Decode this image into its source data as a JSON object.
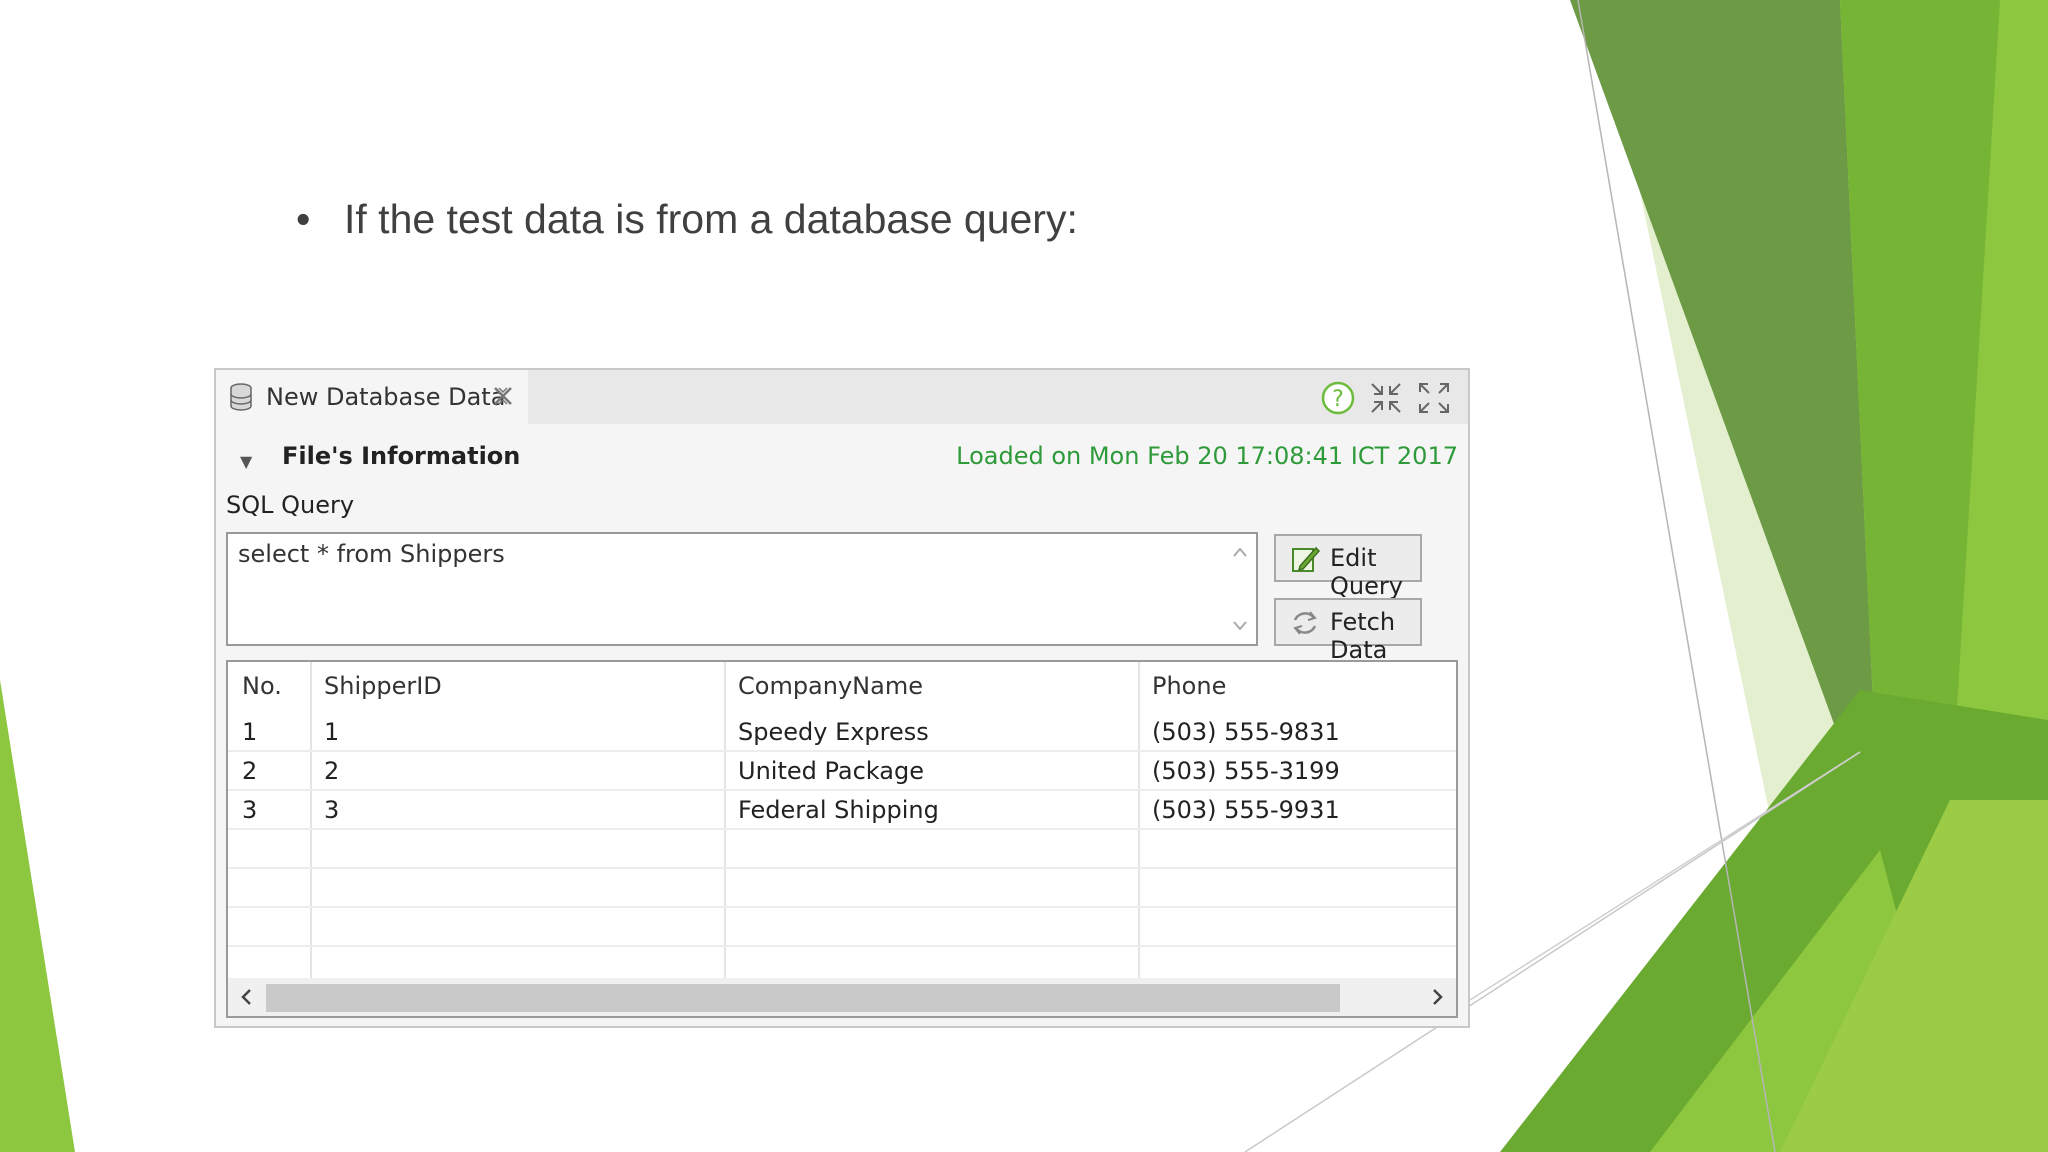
{
  "slide": {
    "bullet_symbol": "•",
    "bullet_text": "If the test data is from a database query:"
  },
  "window": {
    "tab_title": "New Database Data",
    "tab_icon": "database-icon",
    "tab_close_icon": "close-icon",
    "toolbar_icons": [
      "help-icon",
      "minimize-icon",
      "maximize-icon"
    ],
    "section_title": "File's Information",
    "section_toggle": "▼",
    "loaded_text": "Loaded on Mon Feb 20 17:08:41 ICT 2017",
    "sql_label": "SQL Query",
    "sql_value": "select * from Shippers",
    "edit_button": "Edit Query",
    "fetch_button": "Fetch Data",
    "loaded_color": "#2e9a3a"
  },
  "table": {
    "headers": [
      "No.",
      "ShipperID",
      "CompanyName",
      "Phone"
    ],
    "rows": [
      [
        "1",
        "1",
        "Speedy Express",
        "(503) 555-9831"
      ],
      [
        "2",
        "2",
        "United Package",
        "(503) 555-3199"
      ],
      [
        "3",
        "3",
        "Federal Shipping",
        "(503) 555-9931"
      ]
    ],
    "scroll_position": 0.92
  },
  "theme": {
    "accent_dark": "#5e8c3a",
    "accent_light": "#8dc63f"
  }
}
